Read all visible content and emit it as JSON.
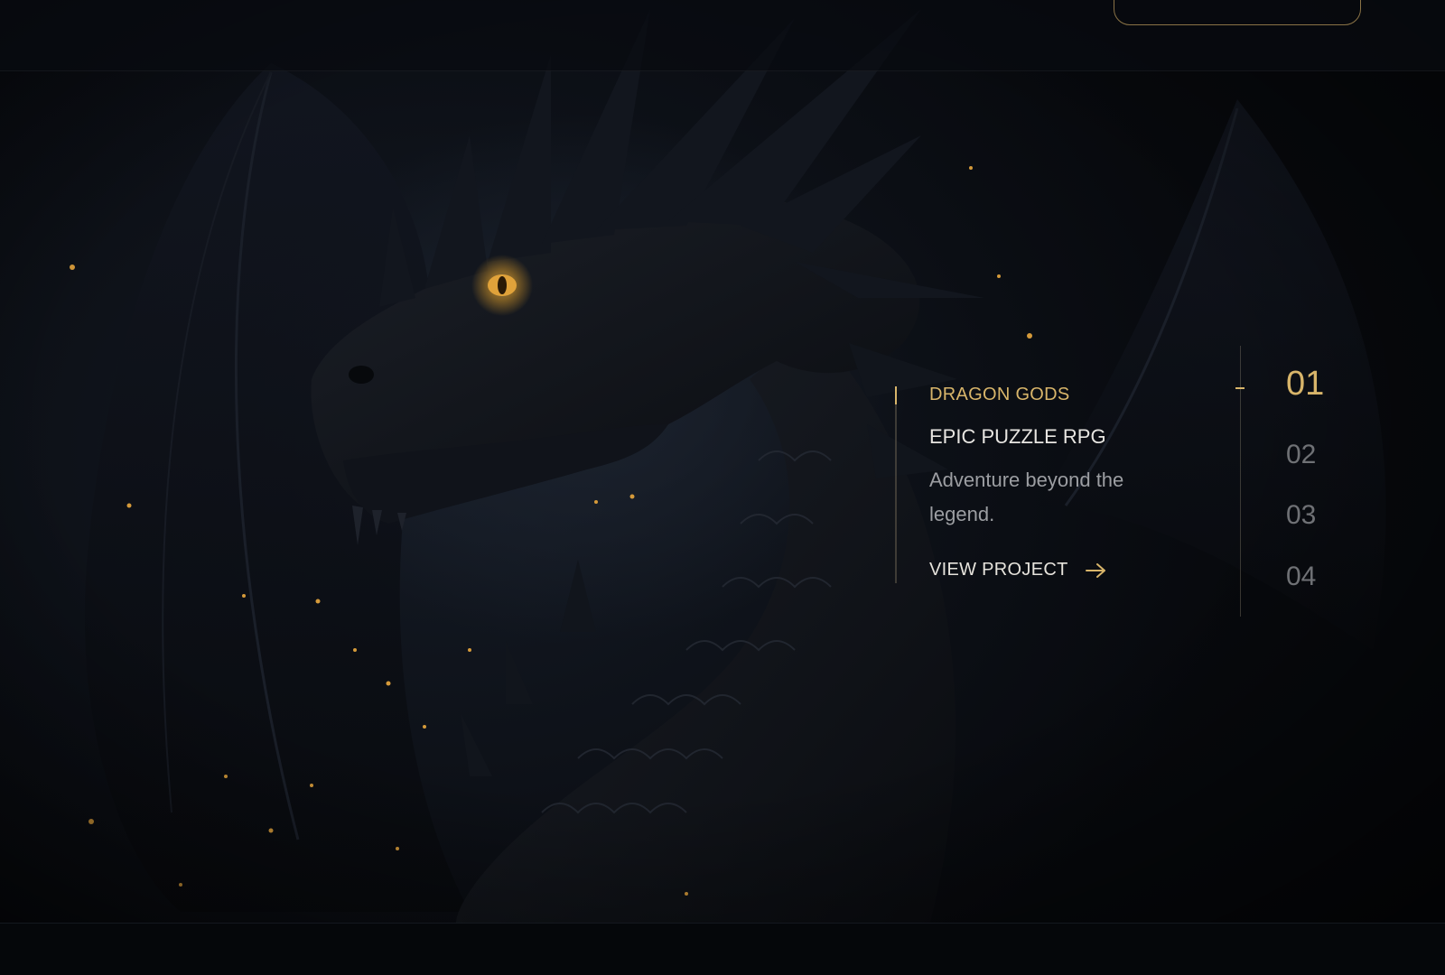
{
  "project": {
    "eyebrow": "DRAGON GODS",
    "title": "EPIC PUZZLE RPG",
    "tagline": "Adventure beyond the legend.",
    "cta_label": "VIEW PROJECT",
    "cta_icon": "arrow-right-icon"
  },
  "steps": [
    {
      "label": "01",
      "active": true
    },
    {
      "label": "02",
      "active": false
    },
    {
      "label": "03",
      "active": false
    },
    {
      "label": "04",
      "active": false
    }
  ],
  "colors": {
    "accent": "#d8b56a",
    "background": "#07090d",
    "text": "#e8e6e2",
    "muted": "#9c9ea2",
    "inactive_step": "#6f7175"
  },
  "hero_image": "dragon-illustration"
}
